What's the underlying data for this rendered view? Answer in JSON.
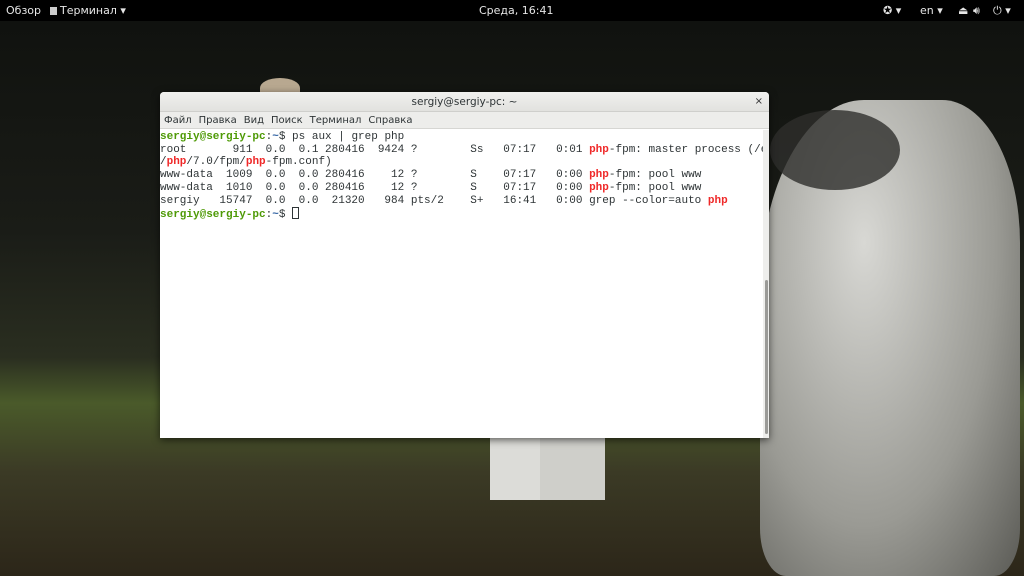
{
  "topbar": {
    "overview": "Обзор",
    "app": "Терминал ▾",
    "clock": "Среда, 16:41",
    "lang": "en ▾",
    "accessibility": "accessibility-icon",
    "volume": "volume-icon",
    "power": "power-icon"
  },
  "window": {
    "title": "sergiy@sergiy-pc: ~",
    "close": "×",
    "menu": [
      "Файл",
      "Правка",
      "Вид",
      "Поиск",
      "Терминал",
      "Справка"
    ]
  },
  "terminal": {
    "lines": [
      [
        {
          "t": "sergiy@sergiy-pc",
          "c": "prompt"
        },
        {
          "t": ":",
          "c": "colon"
        },
        {
          "t": "~",
          "c": "path"
        },
        {
          "t": "$ ps aux | grep php",
          "c": ""
        }
      ],
      [
        {
          "t": "root       911  0.0  0.1 280416  9424 ?        Ss   07:17   0:01 ",
          "c": ""
        },
        {
          "t": "php",
          "c": "red"
        },
        {
          "t": "-fpm: master process (/etc",
          "c": ""
        }
      ],
      [
        {
          "t": "/",
          "c": ""
        },
        {
          "t": "php",
          "c": "red"
        },
        {
          "t": "/7.0/fpm/",
          "c": ""
        },
        {
          "t": "php",
          "c": "red"
        },
        {
          "t": "-fpm.conf)",
          "c": ""
        }
      ],
      [
        {
          "t": "www-data  1009  0.0  0.0 280416    12 ?        S    07:17   0:00 ",
          "c": ""
        },
        {
          "t": "php",
          "c": "red"
        },
        {
          "t": "-fpm: pool www",
          "c": ""
        }
      ],
      [
        {
          "t": "www-data  1010  0.0  0.0 280416    12 ?        S    07:17   0:00 ",
          "c": ""
        },
        {
          "t": "php",
          "c": "red"
        },
        {
          "t": "-fpm: pool www",
          "c": ""
        }
      ],
      [
        {
          "t": "sergiy   15747  0.0  0.0  21320   984 pts/2    S+   16:41   0:00 grep --color=auto ",
          "c": ""
        },
        {
          "t": "php",
          "c": "red"
        }
      ],
      [
        {
          "t": "sergiy@sergiy-pc",
          "c": "prompt"
        },
        {
          "t": ":",
          "c": "colon"
        },
        {
          "t": "~",
          "c": "path"
        },
        {
          "t": "$ ",
          "c": ""
        }
      ]
    ]
  }
}
